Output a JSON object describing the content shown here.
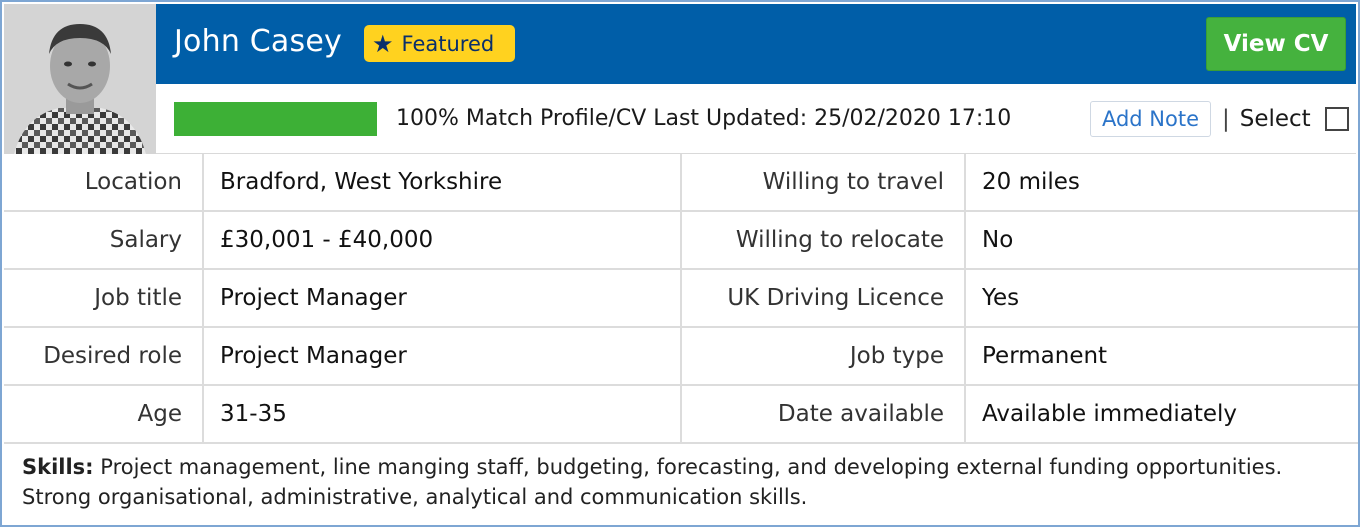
{
  "candidate": {
    "name": "John Casey",
    "featured_label": "Featured",
    "view_cv_label": "View CV"
  },
  "match": {
    "percent": 100,
    "text": "100% Match Profile/CV Last Updated: 25/02/2020 17:10"
  },
  "actions": {
    "add_note_label": "Add Note",
    "separator": "|",
    "select_label": "Select"
  },
  "details": [
    {
      "label": "Location",
      "value": "Bradford, West Yorkshire",
      "label2": "Willing to travel",
      "value2": "20 miles"
    },
    {
      "label": "Salary",
      "value": "£30,001 - £40,000",
      "label2": "Willing to relocate",
      "value2": "No"
    },
    {
      "label": "Job title",
      "value": "Project Manager",
      "label2": "UK Driving Licence",
      "value2": "Yes"
    },
    {
      "label": "Desired role",
      "value": "Project Manager",
      "label2": "Job type",
      "value2": "Permanent"
    },
    {
      "label": "Age",
      "value": "31-35",
      "label2": "Date available",
      "value2": "Available immediately"
    }
  ],
  "skills": {
    "label": "Skills:",
    "text": " Project management, line manging staff, budgeting, forecasting, and developing external funding opportunities. Strong organisational, administrative, analytical and communication skills."
  },
  "colors": {
    "header_bg": "#005ea8",
    "featured_bg": "#ffd21f",
    "view_cv_bg": "#45b23e",
    "match_bar": "#3db036",
    "link": "#2b74c9"
  }
}
